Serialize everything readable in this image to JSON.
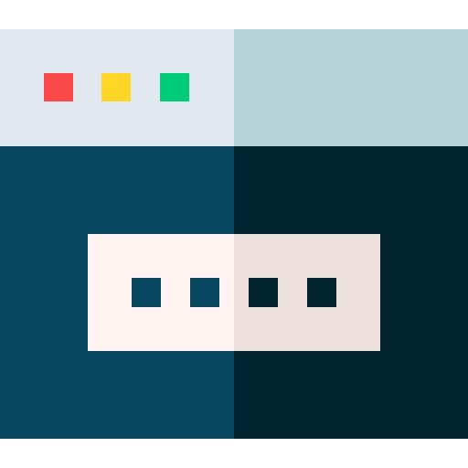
{
  "colors": {
    "titlebar_light": "#E1E8EF",
    "titlebar_shade": "#B5D3D9",
    "body_light": "#09465F",
    "body_shade": "#022431",
    "field_light": "#FEF3F1",
    "field_shade": "#EEE0DC",
    "dot_on_light": "#09465F",
    "dot_on_shade": "#022431",
    "close": "#FC4A4A",
    "minimize": "#FFD625",
    "maximize": "#00CC77"
  },
  "icons": {
    "window": "browser-window-icon",
    "close": "close-window-dot",
    "minimize": "minimize-window-dot",
    "maximize": "maximize-window-dot",
    "password": "password-field-icon"
  }
}
